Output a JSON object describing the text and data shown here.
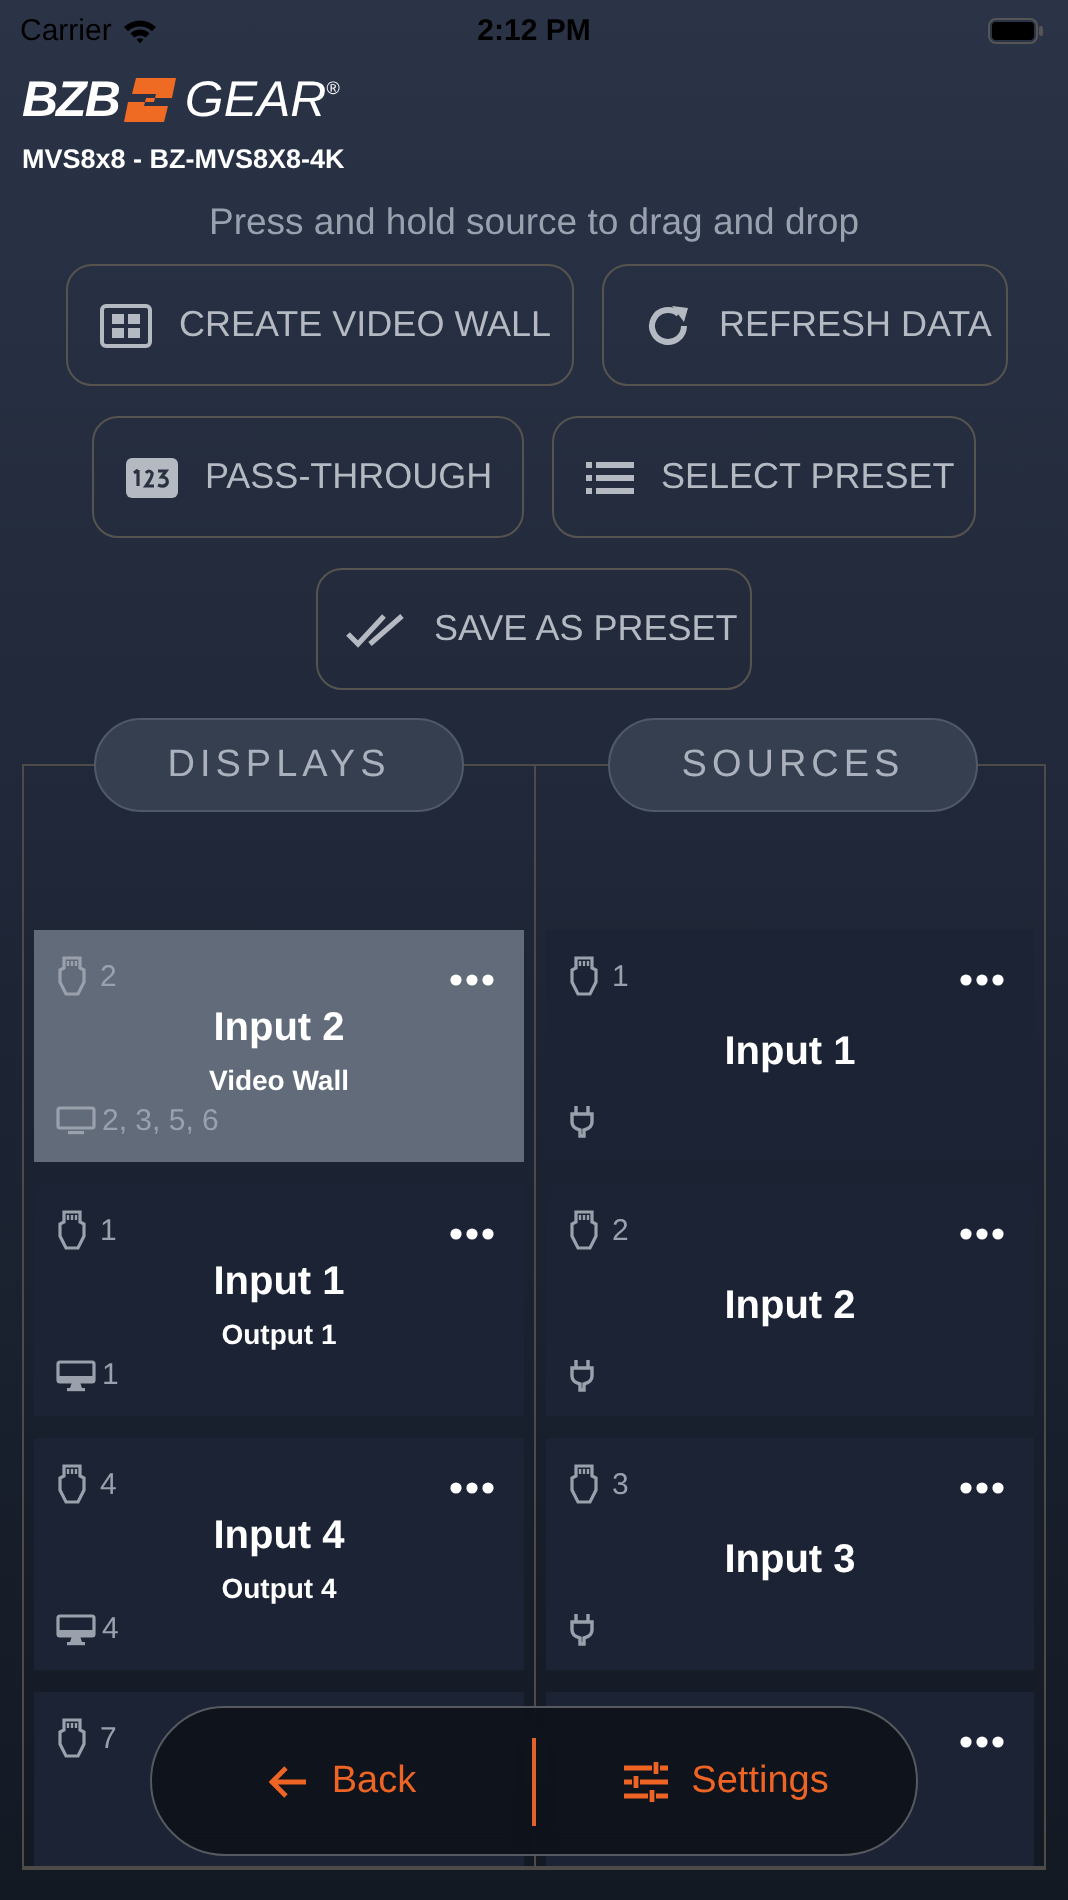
{
  "status_bar": {
    "carrier": "Carrier",
    "time": "2:12 PM"
  },
  "brand": {
    "left": "BZB",
    "right": "GEAR",
    "mark": "®"
  },
  "device": "MVS8x8 - BZ-MVS8X8-4K",
  "hint": "Press and hold source to drag and drop",
  "action_rows": [
    [
      {
        "label": "CREATE VIDEO WALL",
        "kind": "grid"
      },
      {
        "label": "REFRESH DATA",
        "kind": "refresh"
      }
    ],
    [
      {
        "label": "PASS-THROUGH",
        "kind": "numbers"
      },
      {
        "label": "SELECT PRESET",
        "kind": "list"
      }
    ],
    [
      {
        "label": "SAVE AS PRESET",
        "kind": "check"
      }
    ]
  ],
  "tabs": [
    {
      "label": "DISPLAYS"
    },
    {
      "label": "SOURCES"
    }
  ],
  "displays": [
    {
      "kind": "wall",
      "source": "2",
      "title": "Input 2",
      "subtitle": "Video Wall",
      "outputs": "2, 3, 5, 6",
      "selected": true
    },
    {
      "kind": "single",
      "source": "1",
      "title": "Input 1",
      "subtitle": "Output 1",
      "outputs": "1",
      "selected": false
    },
    {
      "kind": "single",
      "source": "4",
      "title": "Input 4",
      "subtitle": "Output 4",
      "outputs": "4",
      "selected": false
    },
    {
      "source": "7",
      "selected": false
    }
  ],
  "sources": [
    {
      "number": "1",
      "title": "Input 1",
      "selected": false
    },
    {
      "number": "2",
      "title": "Input 2",
      "selected": false
    },
    {
      "number": "3",
      "title": "Input 3",
      "selected": false
    },
    {
      "selected": false
    }
  ],
  "bottom_bar": {
    "back": "Back",
    "settings": "Settings"
  }
}
